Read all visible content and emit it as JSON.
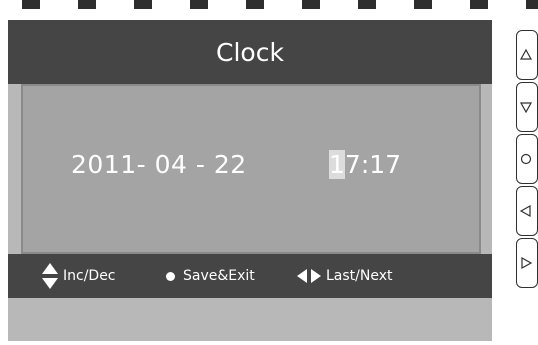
{
  "screen": {
    "title": "Clock",
    "date": {
      "year": "2011",
      "sep1": "- ",
      "month": "04",
      "sep2": " - ",
      "day": "22"
    },
    "time": {
      "hour_first_digit": "1",
      "hour_rest": "7",
      "colon": ":",
      "minute": "17"
    },
    "footer": {
      "inc_dec": "Inc/Dec",
      "save_exit": "Save&Exit",
      "last_next": "Last/Next"
    }
  },
  "side_buttons": [
    {
      "icon": "triangle-up-icon"
    },
    {
      "icon": "triangle-down-icon"
    },
    {
      "icon": "circle-icon"
    },
    {
      "icon": "triangle-left-icon"
    },
    {
      "icon": "triangle-right-icon"
    }
  ],
  "colors": {
    "title_bar": "#454545",
    "panel": "#a4a4a4",
    "screen_bg": "#b8b8b8",
    "cursor_highlight": "#dcdcdc"
  }
}
